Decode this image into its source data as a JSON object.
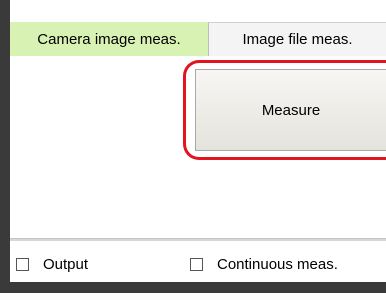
{
  "tabs": [
    {
      "label": "Camera image meas.",
      "active": true
    },
    {
      "label": "Image file meas.",
      "active": false
    }
  ],
  "measure_button": {
    "label": "Measure",
    "highlight_color": "#e1141f"
  },
  "options": [
    {
      "label": "Output",
      "checked": false
    },
    {
      "label": "Continuous meas.",
      "checked": false
    }
  ],
  "colors": {
    "active_tab": "#d8f2b4",
    "frame": "#3a3a3a"
  }
}
